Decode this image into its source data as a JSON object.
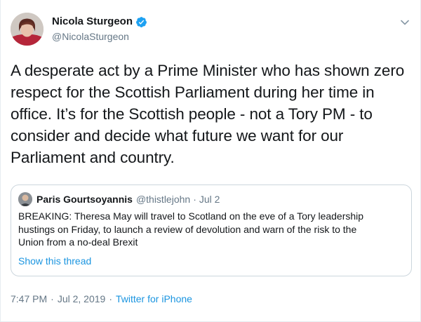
{
  "author": {
    "display_name": "Nicola Sturgeon",
    "handle": "@NicolaSturgeon",
    "avatar_icon": "user-avatar",
    "verified_icon": "verified-badge-icon"
  },
  "tweet": {
    "text": "A desperate act by a Prime Minister who has shown zero\nrespect for the Scottish Parliament during her time in\noffice. It’s for the Scottish people - not a Tory PM - to\nconsider and decide what future we want for our\nParliament and country."
  },
  "quoted_tweet": {
    "display_name": "Paris Gourtsoyannis",
    "handle": "@thistlejohn",
    "separator": "·",
    "date": "Jul 2",
    "text": "BREAKING: Theresa May will travel to Scotland on the eve of a Tory leadership\nhustings on Friday, to launch a review of devolution and warn of the risk to the\nUnion from a no-deal Brexit",
    "show_thread": "Show this thread"
  },
  "meta": {
    "time": "7:47 PM",
    "date": "Jul 2, 2019",
    "separator": "·",
    "source": "Twitter for iPhone"
  },
  "colors": {
    "text": "#14171a",
    "secondary": "#657786",
    "link": "#1b95e0",
    "verified": "#1da1f2",
    "border": "#ccd6dd"
  },
  "icons": {
    "caret": "chevron-down-icon"
  }
}
